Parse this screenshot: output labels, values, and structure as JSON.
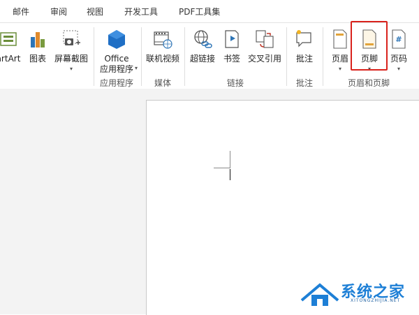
{
  "tabs": [
    "邮件",
    "审阅",
    "视图",
    "开发工具",
    "PDF工具集"
  ],
  "buttons": {
    "smartart": "artArt",
    "chart": "图表",
    "screenshot": "屏幕截图",
    "office_line1": "Office",
    "office_line2": "应用程序",
    "online_video": "联机视频",
    "hyperlink": "超链接",
    "bookmark": "书签",
    "cross_reference": "交叉引用",
    "comment": "批注",
    "header": "页眉",
    "footer": "页脚",
    "page_number": "页码"
  },
  "groups": {
    "apps": "应用程序",
    "media": "媒体",
    "links": "链接",
    "comments": "批注",
    "header_footer": "页眉和页脚"
  },
  "watermark": {
    "main": "系统之家",
    "sub": "XITONGZHIJIA.NET"
  },
  "colors": {
    "highlight": "#d9221c",
    "office_blue": "#1f6fc5",
    "footer_orange": "#e2a33a",
    "watermark_blue": "#1d7fd6"
  }
}
